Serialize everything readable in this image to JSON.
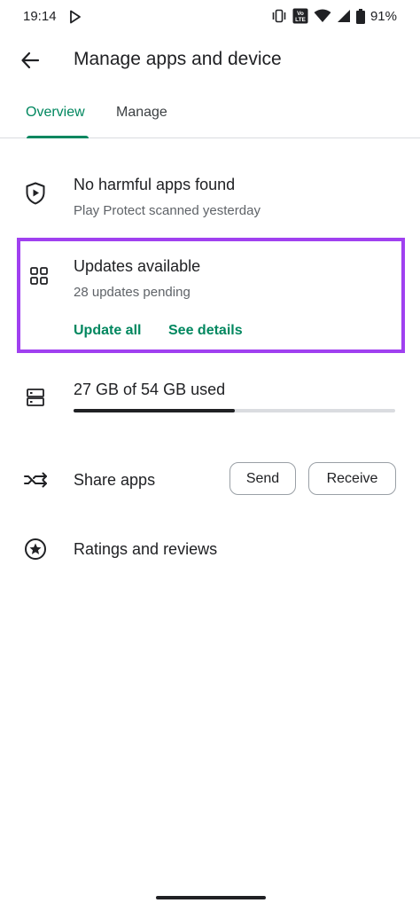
{
  "status_bar": {
    "time": "19:14",
    "battery": "91%",
    "volte_label": "Vo LTE",
    "icons": [
      "play-store-icon",
      "vibrate-icon",
      "volte-icon",
      "wifi-icon",
      "signal-icon",
      "battery-icon"
    ]
  },
  "header": {
    "title": "Manage apps and device",
    "back_icon": "arrow-back-icon"
  },
  "tabs": [
    {
      "label": "Overview",
      "active": true
    },
    {
      "label": "Manage",
      "active": false
    }
  ],
  "protect": {
    "icon": "shield-play-icon",
    "title": "No harmful apps found",
    "subtitle": "Play Protect scanned yesterday"
  },
  "updates": {
    "icon": "apps-grid-icon",
    "title": "Updates available",
    "subtitle": "28 updates pending",
    "update_all_label": "Update all",
    "see_details_label": "See details",
    "highlight_color": "#a040f0"
  },
  "storage": {
    "icon": "storage-icon",
    "text": "27 GB of 54 GB used",
    "used_fraction": 0.5
  },
  "share": {
    "icon": "share-apps-icon",
    "label": "Share apps",
    "send_label": "Send",
    "receive_label": "Receive"
  },
  "ratings": {
    "icon": "star-circle-icon",
    "label": "Ratings and reviews"
  },
  "colors": {
    "accent": "#01875f",
    "text_primary": "#202124",
    "text_secondary": "#5f6368",
    "divider": "#dadce0"
  }
}
